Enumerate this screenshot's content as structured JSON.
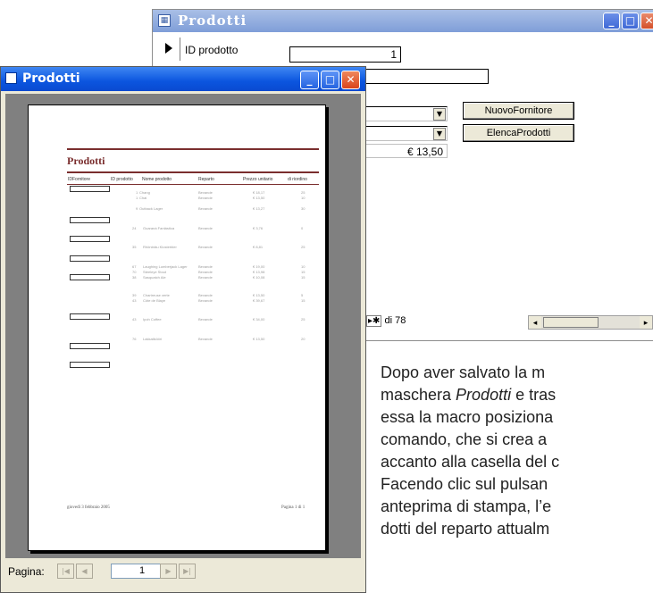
{
  "back_window": {
    "title": "Prodotti",
    "id_label": "ID prodotto",
    "id_value": "1",
    "price_value": "€ 13,50",
    "buttons": [
      "NuovoFornitore",
      "ElencaProdotti"
    ],
    "nav_count": "di 78"
  },
  "front_window": {
    "title": "Prodotti",
    "report": {
      "title": "Prodotti",
      "columns": [
        "IDFornitore",
        "ID prodotto",
        "Nome prodotto",
        "Reparto",
        "Prezzo unitario",
        "di riordino"
      ],
      "rows": [
        {
          "id": "1",
          "name": "Chang",
          "reparto": "Bevande",
          "prezzo": "€ 18,17",
          "riordino": "25"
        },
        {
          "id": "1",
          "name": "Chai",
          "reparto": "Bevande",
          "prezzo": "€ 13,50",
          "riordino": "10"
        },
        {
          "id": "9",
          "name": "Outback Lager",
          "reparto": "Bevande",
          "prezzo": "€ 13,27",
          "riordino": "30"
        },
        {
          "id": "24",
          "name": "Guaraná Fantástica",
          "reparto": "Bevande",
          "prezzo": "€ 3,76",
          "riordino": "0"
        },
        {
          "id": "35",
          "name": "Rhönbräu Klosterbier",
          "reparto": "Bevande",
          "prezzo": "€ 8,81",
          "riordino": "25"
        },
        {
          "id": "67",
          "name": "Laughing Lumberjack Lager",
          "reparto": "Bevande",
          "prezzo": "€ 19,00",
          "riordino": "10"
        },
        {
          "id": "70",
          "name": "Steeleye Stout",
          "reparto": "Bevande",
          "prezzo": "€ 13,98",
          "riordino": "15"
        },
        {
          "id": "38",
          "name": "Sasquatch Ale",
          "reparto": "Bevande",
          "prezzo": "€ 10,08",
          "riordino": "15"
        },
        {
          "id": "39",
          "name": "Chartreuse verte",
          "reparto": "Bevande",
          "prezzo": "€ 13,50",
          "riordino": "5"
        },
        {
          "id": "43",
          "name": "Côte de Blaye",
          "reparto": "Bevande",
          "prezzo": "€ 39,67",
          "riordino": "15"
        },
        {
          "id": "43",
          "name": "Ipoh Coffee",
          "reparto": "Bevande",
          "prezzo": "€ 34,00",
          "riordino": "25"
        },
        {
          "id": "76",
          "name": "Lakkalikööri",
          "reparto": "Bevande",
          "prezzo": "€ 13,50",
          "riordino": "20"
        }
      ],
      "date": "giovedì 3 febbraio 2005",
      "page_footer": "Pagina 1 di 1"
    },
    "pager": {
      "label": "Pagina:",
      "value": "1"
    }
  },
  "description": [
    "Dopo aver salvato la m",
    "maschera Prodotti e tras",
    "essa la macro posiziona",
    "comando, che si crea a",
    "accanto alla casella del c",
    "Facendo clic sul pulsan",
    "anteprima di stampa, l’e",
    "dotti del reparto attualm"
  ]
}
